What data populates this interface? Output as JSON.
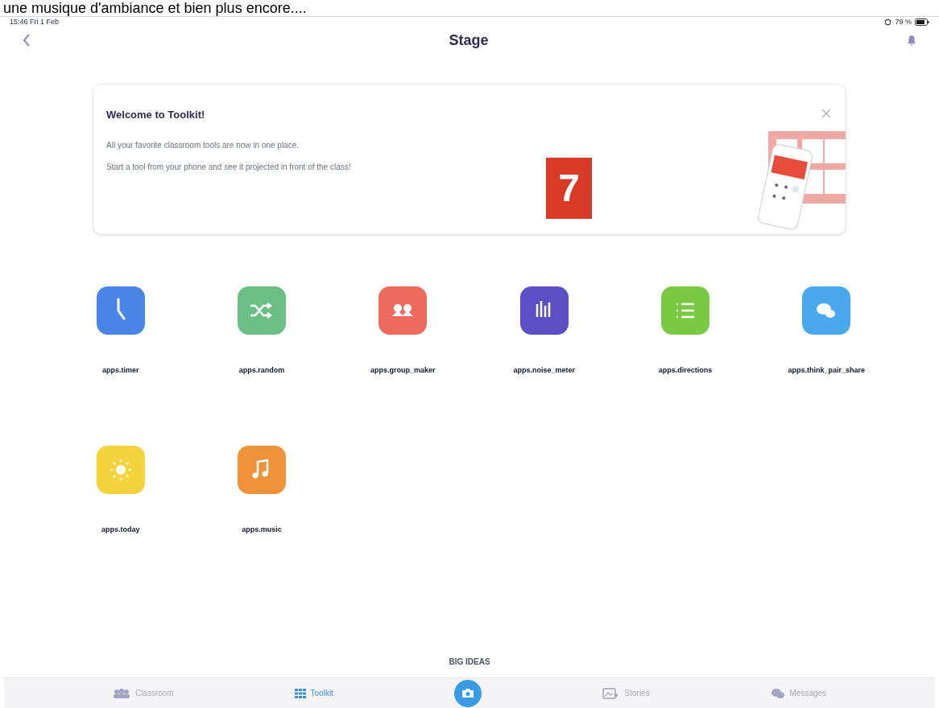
{
  "caption": "une musique d'ambiance et bien plus encore....",
  "status_bar": {
    "time": "15:46",
    "date": "Fri 1 Feb",
    "battery": "79 %"
  },
  "header": {
    "title": "Stage"
  },
  "welcome_card": {
    "title": "Welcome to Toolkit!",
    "lines": [
      "All your favorite classroom tools are now in one place.",
      "Start a tool from your phone and see it projected in front of the class!"
    ],
    "badge": "7"
  },
  "apps": [
    {
      "label": "apps.timer",
      "kind": "timer",
      "color": "#4a86e8"
    },
    {
      "label": "apps.random",
      "kind": "random",
      "color": "#6cbf84"
    },
    {
      "label": "apps.group_maker",
      "kind": "group",
      "color": "#ec6a5e"
    },
    {
      "label": "apps.noise_meter",
      "kind": "meter",
      "color": "#5a4fc4"
    },
    {
      "label": "apps.directions",
      "kind": "list",
      "color": "#7ac943"
    },
    {
      "label": "apps.think_pair_share",
      "kind": "chat",
      "color": "#4aa8ec"
    },
    {
      "label": "apps.today",
      "kind": "sun",
      "color": "#f5d33d"
    },
    {
      "label": "apps.music",
      "kind": "music",
      "color": "#f0923a"
    }
  ],
  "footer_link": "BIG IDEAS",
  "tab_bar": [
    {
      "label": "Classroom",
      "kind": "classroom",
      "selected": false
    },
    {
      "label": "Toolkit",
      "kind": "grid",
      "selected": true
    },
    {
      "kind": "camera",
      "selected": false
    },
    {
      "label": "Stories",
      "kind": "stories",
      "selected": false
    },
    {
      "label": "Messages",
      "kind": "messages",
      "selected": false
    }
  ]
}
